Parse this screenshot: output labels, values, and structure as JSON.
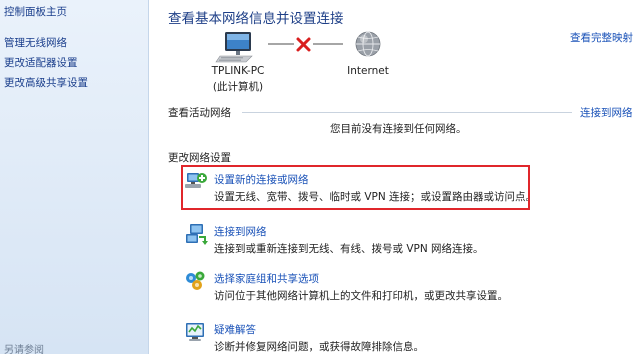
{
  "sidebar": {
    "items": [
      {
        "label": "控制面板主页"
      },
      {
        "label": "管理无线网络"
      },
      {
        "label": "更改适配器设置"
      },
      {
        "label": "更改高级共享设置"
      }
    ],
    "see_also": "另请参阅"
  },
  "header": {
    "title": "查看基本网络信息并设置连接",
    "full_map_link": "查看完整映射"
  },
  "network_map": {
    "computer_name": "TPLINK-PC",
    "computer_sub": "(此计算机)",
    "internet_label": "Internet",
    "connection_status": "disconnected"
  },
  "active_networks": {
    "title": "查看活动网络",
    "connect_link": "连接到网络",
    "status": "您目前没有连接到任何网络。"
  },
  "change_settings": {
    "title": "更改网络设置",
    "tasks": [
      {
        "title": "设置新的连接或网络",
        "desc": "设置无线、宽带、拨号、临时或 VPN 连接；或设置路由器或访问点。",
        "icon": "new-connection-icon"
      },
      {
        "title": "连接到网络",
        "desc": "连接到或重新连接到无线、有线、拨号或 VPN 网络连接。",
        "icon": "connect-network-icon"
      },
      {
        "title": "选择家庭组和共享选项",
        "desc": "访问位于其他网络计算机上的文件和打印机，或更改共享设置。",
        "icon": "homegroup-icon"
      },
      {
        "title": "疑难解答",
        "desc": "诊断并修复网络问题，或获得故障排除信息。",
        "icon": "troubleshoot-icon"
      }
    ]
  },
  "colors": {
    "link": "#1a52b8",
    "title": "#1e3f87",
    "highlight": "#e0262b",
    "sidebar_bg": "#dfeaf7"
  }
}
